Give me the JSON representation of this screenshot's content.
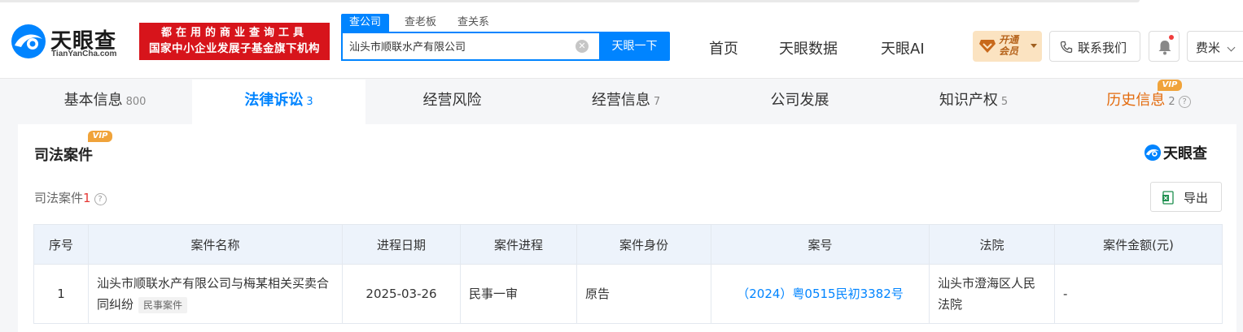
{
  "header": {
    "logo_text": "天眼查",
    "logo_url": "TianYanCha.com",
    "badge_line1": "都在用的商业查询工具",
    "badge_line2": "国家中小企业发展子基金旗下机构",
    "search_tabs": [
      "查公司",
      "查老板",
      "查关系"
    ],
    "search_value": "汕头市顺联水产有限公司",
    "search_button": "天眼一下",
    "clear_symbol": "✕",
    "nav": [
      "首页",
      "天眼数据",
      "天眼AI"
    ],
    "vip_label_line1": "开通",
    "vip_label_line2": "会员",
    "contact_label": "联系我们",
    "user_name": "费米"
  },
  "tabs": [
    {
      "label": "基本信息",
      "count": "800"
    },
    {
      "label": "法律诉讼",
      "count": "3"
    },
    {
      "label": "经营风险",
      "count": ""
    },
    {
      "label": "经营信息",
      "count": "7"
    },
    {
      "label": "公司发展",
      "count": ""
    },
    {
      "label": "知识产权",
      "count": "5"
    },
    {
      "label": "历史信息",
      "count": "2"
    }
  ],
  "vip_tag": "VIP",
  "help_symbol": "?",
  "card": {
    "title": "司法案件",
    "watermark": "天眼查",
    "subtitle": "司法案件",
    "subtitle_count": "1",
    "export_label": "导出"
  },
  "table": {
    "headers": [
      "序号",
      "案件名称",
      "进程日期",
      "案件进程",
      "案件身份",
      "案号",
      "法院",
      "案件金额(元)"
    ],
    "rows": [
      {
        "index": "1",
        "name": "汕头市顺联水产有限公司与梅某相关买卖合同纠纷",
        "name_tag": "民事案件",
        "date": "2025-03-26",
        "stage": "民事一审",
        "role": "原告",
        "case_no": "（2024）粤0515民初3382号",
        "court": "汕头市澄海区人民法院",
        "amount": "-"
      }
    ]
  },
  "colors": {
    "primary": "#0084ff",
    "brand_red": "#d7141b",
    "history_orange": "#e36b0e",
    "vip_gold": "#f0a33a"
  }
}
